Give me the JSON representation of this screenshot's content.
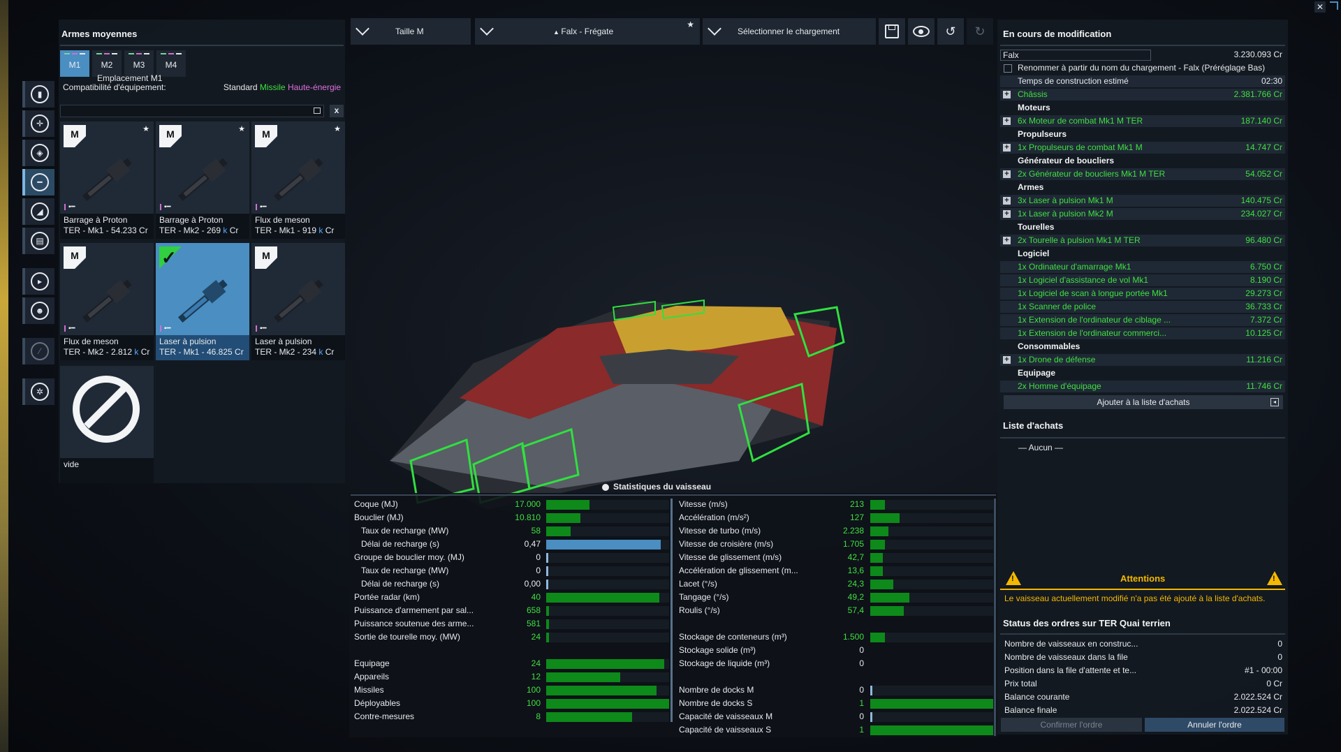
{
  "left_panel": {
    "title": "Armes moyennes",
    "tabs": [
      "M1",
      "M2",
      "M3",
      "M4"
    ],
    "tooltip": "Emplacement M1",
    "compat_label": "Compatibilité d'équipement:",
    "compat_standard": "Standard",
    "compat_missile": "Missile",
    "compat_he": "Haute-énergie",
    "search_placeholder": "",
    "clear_label": "x",
    "cards": [
      {
        "name": "Barrage à Proton",
        "line": "TER - Mk1 - 54.233 Cr",
        "k": false,
        "starred": true,
        "selected": false
      },
      {
        "name": "Barrage à Proton",
        "line": "TER - Mk2 - 269 ",
        "k": true,
        "starred": true,
        "selected": false
      },
      {
        "name": "Flux de meson",
        "line": "TER - Mk1 - 919 ",
        "k": true,
        "starred": true,
        "selected": false
      },
      {
        "name": "Flux de meson",
        "line": "TER - Mk2 - 2.812 ",
        "k": true,
        "starred": false,
        "selected": false
      },
      {
        "name": "Laser à pulsion",
        "line": "TER - Mk1 - 46.825 Cr",
        "k": false,
        "starred": false,
        "selected": true
      },
      {
        "name": "Laser à pulsion",
        "line": "TER - Mk2 - 234 ",
        "k": true,
        "starred": false,
        "selected": false
      }
    ],
    "k_suffix": "k",
    "cr_suffix": " Cr",
    "empty_label": "vide"
  },
  "toolbar": {
    "size": "Taille M",
    "ship": "Falx - Frégate",
    "loadout": "Sélectionner le chargement"
  },
  "right_panel": {
    "title": "En cours de modification",
    "ship_name": "Falx",
    "ship_price": "3.230.093 Cr",
    "rename_label": "Renommer à partir du nom du chargement - Falx (Préréglage Bas)",
    "build_time_label": "Temps de construction estimé",
    "build_time": "02:30",
    "rows": [
      {
        "type": "item",
        "plus": true,
        "name": "Châssis",
        "value": "2.381.766 Cr"
      },
      {
        "type": "cat",
        "name": "Moteurs"
      },
      {
        "type": "item",
        "plus": true,
        "name": "6x Moteur de combat Mk1 M  TER",
        "value": "187.140 Cr"
      },
      {
        "type": "cat",
        "name": "Propulseurs"
      },
      {
        "type": "item",
        "plus": true,
        "name": "1x Propulseurs de combat Mk1 M",
        "value": "14.747 Cr"
      },
      {
        "type": "cat",
        "name": "Générateur de boucliers"
      },
      {
        "type": "item",
        "plus": true,
        "name": "2x Générateur de boucliers Mk1  M  TER",
        "value": "54.052 Cr"
      },
      {
        "type": "cat",
        "name": "Armes"
      },
      {
        "type": "item",
        "plus": true,
        "name": "3x Laser à pulsion Mk1 M",
        "value": "140.475 Cr"
      },
      {
        "type": "item",
        "plus": true,
        "name": "1x Laser à pulsion Mk2 M",
        "value": "234.027 Cr"
      },
      {
        "type": "cat",
        "name": "Tourelles"
      },
      {
        "type": "item",
        "plus": true,
        "name": "2x Tourelle à pulsion Mk1 M  TER",
        "value": "96.480 Cr"
      },
      {
        "type": "cat",
        "name": "Logiciel"
      },
      {
        "type": "item",
        "plus": false,
        "name": "1x Ordinateur d'amarrage Mk1",
        "value": "6.750 Cr"
      },
      {
        "type": "item",
        "plus": false,
        "name": "1x Logiciel d'assistance de vol Mk1",
        "value": "8.190 Cr"
      },
      {
        "type": "item",
        "plus": false,
        "name": "1x Logiciel de scan à longue portée Mk1",
        "value": "29.273 Cr"
      },
      {
        "type": "item",
        "plus": false,
        "name": "1x Scanner de police",
        "value": "36.733 Cr"
      },
      {
        "type": "item",
        "plus": false,
        "name": "1x Extension de l'ordinateur de ciblage ...",
        "value": "7.372 Cr"
      },
      {
        "type": "item",
        "plus": false,
        "name": "1x Extension de l'ordinateur commerci...",
        "value": "10.125 Cr"
      },
      {
        "type": "cat",
        "name": "Consommables"
      },
      {
        "type": "item",
        "plus": true,
        "name": "1x Drone de défense",
        "value": "11.216 Cr"
      },
      {
        "type": "cat",
        "name": "Equipage"
      },
      {
        "type": "item",
        "plus": false,
        "name": "2x Homme d'équipage",
        "value": "11.746 Cr"
      }
    ],
    "add_to_list": "Ajouter à la liste d'achats",
    "shopping_title": "Liste d'achats",
    "shopping_empty": "— Aucun —",
    "attention_title": "Attentions",
    "attention_msg": "Le vaisseau actuellement modifié n'a pas été ajouté à la liste d'achats.",
    "orders_title": "Status des ordres sur TER Quai terrien",
    "orders": [
      {
        "label": "Nombre de vaisseaux en construc...",
        "value": "0"
      },
      {
        "label": "Nombre de vaisseaux dans la file",
        "value": "0"
      },
      {
        "label": "Position dans la file d'attente et te...",
        "value": "#1 - 00:00"
      },
      {
        "label": "Prix total",
        "value": "0 Cr"
      },
      {
        "label": "Balance courante",
        "value": "2.022.524 Cr"
      },
      {
        "label": "Balance finale",
        "value": "2.022.524 Cr"
      }
    ],
    "confirm": "Confirmer l'ordre",
    "cancel": "Annuler l'ordre"
  },
  "stats": {
    "title": "Statistiques du vaisseau",
    "left": [
      {
        "label": "Coque (MJ)",
        "value": "17.000",
        "fill": 0.35,
        "indent": false,
        "color": "green"
      },
      {
        "label": "Bouclier (MJ)",
        "value": "10.810",
        "fill": 0.28,
        "indent": false,
        "color": "green"
      },
      {
        "label": "Taux de recharge (MW)",
        "value": "58",
        "fill": 0.2,
        "indent": true,
        "color": "green"
      },
      {
        "label": "Délai de recharge (s)",
        "value": "0,47",
        "fill": 0.93,
        "indent": true,
        "color": "blue"
      },
      {
        "label": "Groupe de bouclier moy. (MJ)",
        "value": "0",
        "fill": 0,
        "indent": false,
        "color": "green"
      },
      {
        "label": "Taux de recharge (MW)",
        "value": "0",
        "fill": 0,
        "indent": true,
        "color": "green"
      },
      {
        "label": "Délai de recharge (s)",
        "value": "0,00",
        "fill": 0,
        "indent": true,
        "color": "green"
      },
      {
        "label": "Portée radar (km)",
        "value": "40",
        "fill": 0.92,
        "indent": false,
        "color": "green"
      },
      {
        "label": "Puissance d'armement par sal...",
        "value": "658",
        "fill": 0.02,
        "indent": false,
        "color": "green"
      },
      {
        "label": "Puissance soutenue des arme...",
        "value": "581",
        "fill": 0.02,
        "indent": false,
        "color": "green"
      },
      {
        "label": "Sortie de tourelle moy. (MW)",
        "value": "24",
        "fill": 0.02,
        "indent": false,
        "color": "green"
      },
      {
        "label": "",
        "value": "",
        "fill": -1,
        "indent": false,
        "color": "green"
      },
      {
        "label": "Equipage",
        "value": "24",
        "fill": 0.96,
        "indent": false,
        "color": "green"
      },
      {
        "label": "Appareils",
        "value": "12",
        "fill": 0.6,
        "indent": false,
        "color": "green"
      },
      {
        "label": "Missiles",
        "value": "100",
        "fill": 0.9,
        "indent": false,
        "color": "green"
      },
      {
        "label": "Déployables",
        "value": "100",
        "fill": 1.0,
        "indent": false,
        "color": "green"
      },
      {
        "label": "Contre-mesures",
        "value": "8",
        "fill": 0.7,
        "indent": false,
        "color": "green"
      }
    ],
    "right": [
      {
        "label": "Vitesse (m/s)",
        "value": "213",
        "fill": 0.12,
        "color": "green"
      },
      {
        "label": "Accélération (m/s²)",
        "value": "127",
        "fill": 0.24,
        "color": "green"
      },
      {
        "label": "Vitesse de turbo (m/s)",
        "value": "2.238",
        "fill": 0.15,
        "color": "green"
      },
      {
        "label": "Vitesse de croisière (m/s)",
        "value": "1.705",
        "fill": 0.12,
        "color": "green"
      },
      {
        "label": "Vitesse de glissement (m/s)",
        "value": "42,7",
        "fill": 0.1,
        "color": "green"
      },
      {
        "label": "Accélération de glissement (m...",
        "value": "13,6",
        "fill": 0.1,
        "color": "green"
      },
      {
        "label": "Lacet (°/s)",
        "value": "24,3",
        "fill": 0.19,
        "color": "green"
      },
      {
        "label": "Tangage (°/s)",
        "value": "49,2",
        "fill": 0.32,
        "color": "green"
      },
      {
        "label": "Roulis (°/s)",
        "value": "57,4",
        "fill": 0.27,
        "color": "green"
      },
      {
        "label": "",
        "value": "",
        "fill": -1,
        "color": "green"
      },
      {
        "label": "Stockage de conteneurs (m³)",
        "value": "1.500",
        "fill": 0.12,
        "color": "green"
      },
      {
        "label": "Stockage solide (m³)",
        "value": "0",
        "fill": -1,
        "color": "green"
      },
      {
        "label": "Stockage de liquide (m³)",
        "value": "0",
        "fill": -1,
        "color": "green"
      },
      {
        "label": "",
        "value": "",
        "fill": -1,
        "color": "green"
      },
      {
        "label": "Nombre de docks M",
        "value": "0",
        "fill": 0,
        "color": "green"
      },
      {
        "label": "Nombre de docks S",
        "value": "1",
        "fill": 1.0,
        "color": "green"
      },
      {
        "label": "Capacité de vaisseaux M",
        "value": "0",
        "fill": 0,
        "color": "green"
      },
      {
        "label": "Capacité de vaisseaux S",
        "value": "1",
        "fill": 1.0,
        "color": "green"
      }
    ]
  },
  "colors": {
    "accent_blue": "#4a8ec2",
    "green_text": "#3fe040",
    "bar_green": "#0d8a1a",
    "warn": "#f5b800"
  }
}
